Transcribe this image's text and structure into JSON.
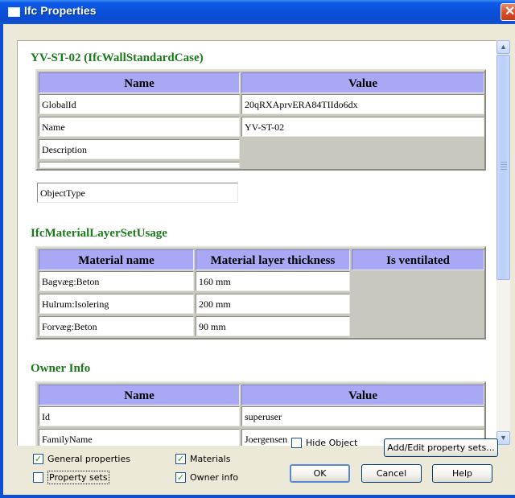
{
  "window": {
    "title": "Ifc Properties",
    "close_glyph": "✕"
  },
  "sections": {
    "element": {
      "title": "YV-ST-02 (IfcWallStandardCase)",
      "headers": [
        "Name",
        "Value"
      ],
      "rows": [
        [
          "GlobalId",
          "20qRXAprvERA84TIIdo6dx"
        ],
        [
          "Name",
          "YV-ST-02"
        ],
        [
          "Description",
          ""
        ],
        [
          "ObjectType",
          ""
        ]
      ]
    },
    "materials": {
      "title": "IfcMaterialLayerSetUsage",
      "headers": [
        "Material name",
        "Material layer thickness",
        "Is ventilated"
      ],
      "rows": [
        [
          "Bagvæg:Beton",
          "160 mm",
          ""
        ],
        [
          "Hulrum:Isolering",
          "200 mm",
          ""
        ],
        [
          "Forvæg:Beton",
          "90 mm",
          ""
        ]
      ]
    },
    "owner": {
      "title": "Owner Info",
      "headers": [
        "Name",
        "Value"
      ],
      "rows": [
        [
          "Id",
          "superuser"
        ],
        [
          "FamilyName",
          "Joergensen"
        ]
      ]
    }
  },
  "checkboxes": {
    "general_properties": {
      "label": "General properties",
      "checked": true
    },
    "property_sets": {
      "label": "Property sets",
      "checked": false
    },
    "materials": {
      "label": "Materials",
      "checked": true
    },
    "owner_info": {
      "label": "Owner info",
      "checked": true
    },
    "hide_object": {
      "label": "Hide Object",
      "checked": false
    }
  },
  "buttons": {
    "add_edit": "Add/Edit property sets...",
    "ok": "OK",
    "cancel": "Cancel",
    "help": "Help"
  },
  "glyphs": {
    "check": "✓",
    "scroll_up": "▲",
    "scroll_down": "▼"
  },
  "colors": {
    "section_title": "#1a7a1a",
    "table_header": "#a8a8f4",
    "titlebar": "#0a50d8",
    "check": "#21a121"
  }
}
